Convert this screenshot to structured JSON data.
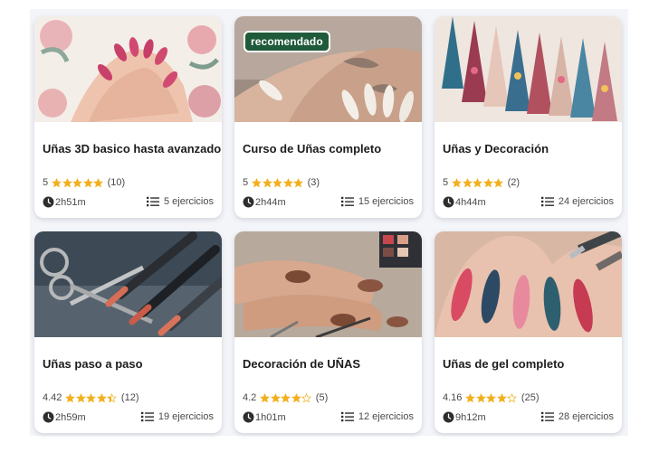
{
  "colors": {
    "star": "#f2b01e",
    "badge_bg": "#1f5a3a",
    "card_bg": "#ffffff",
    "page_bg": "#f3f5f9"
  },
  "courses": [
    {
      "title": "Uñas 3D basico hasta avanzado",
      "rating": "5",
      "stars_filled": 5,
      "reviews": "(10)",
      "duration": "2h51m",
      "exercises": "5 ejercicios",
      "badge": "",
      "image_subject": "hands with pink floral 3D nail art"
    },
    {
      "title": "Curso de Uñas completo",
      "rating": "5",
      "stars_filled": 5,
      "reviews": "(3)",
      "duration": "2h44m",
      "exercises": "15 ejercicios",
      "badge": "recomendado",
      "image_subject": "tattooed hands with white almond nails"
    },
    {
      "title": "Uñas y Decoración",
      "rating": "5",
      "stars_filled": 5,
      "reviews": "(2)",
      "duration": "4h44m",
      "exercises": "24 ejercicios",
      "badge": "",
      "image_subject": "row of decorated stiletto nail tips"
    },
    {
      "title": "Uñas paso a paso",
      "rating": "4.42",
      "stars_filled": 4.42,
      "reviews": "(12)",
      "duration": "2h59m",
      "exercises": "19 ejercicios",
      "badge": "",
      "image_subject": "nail tools, scissors and brushes"
    },
    {
      "title": "Decoración de UÑAS",
      "rating": "4.2",
      "stars_filled": 4.2,
      "reviews": "(5)",
      "duration": "1h01m",
      "exercises": "12 ejercicios",
      "badge": "",
      "image_subject": "hands with leopard nail art and palette"
    },
    {
      "title": "Uñas de gel completo",
      "rating": "4.16",
      "stars_filled": 4.16,
      "reviews": "(25)",
      "duration": "9h12m",
      "exercises": "28 ejercicios",
      "badge": "",
      "image_subject": "long colorful gel nails with brush"
    }
  ]
}
